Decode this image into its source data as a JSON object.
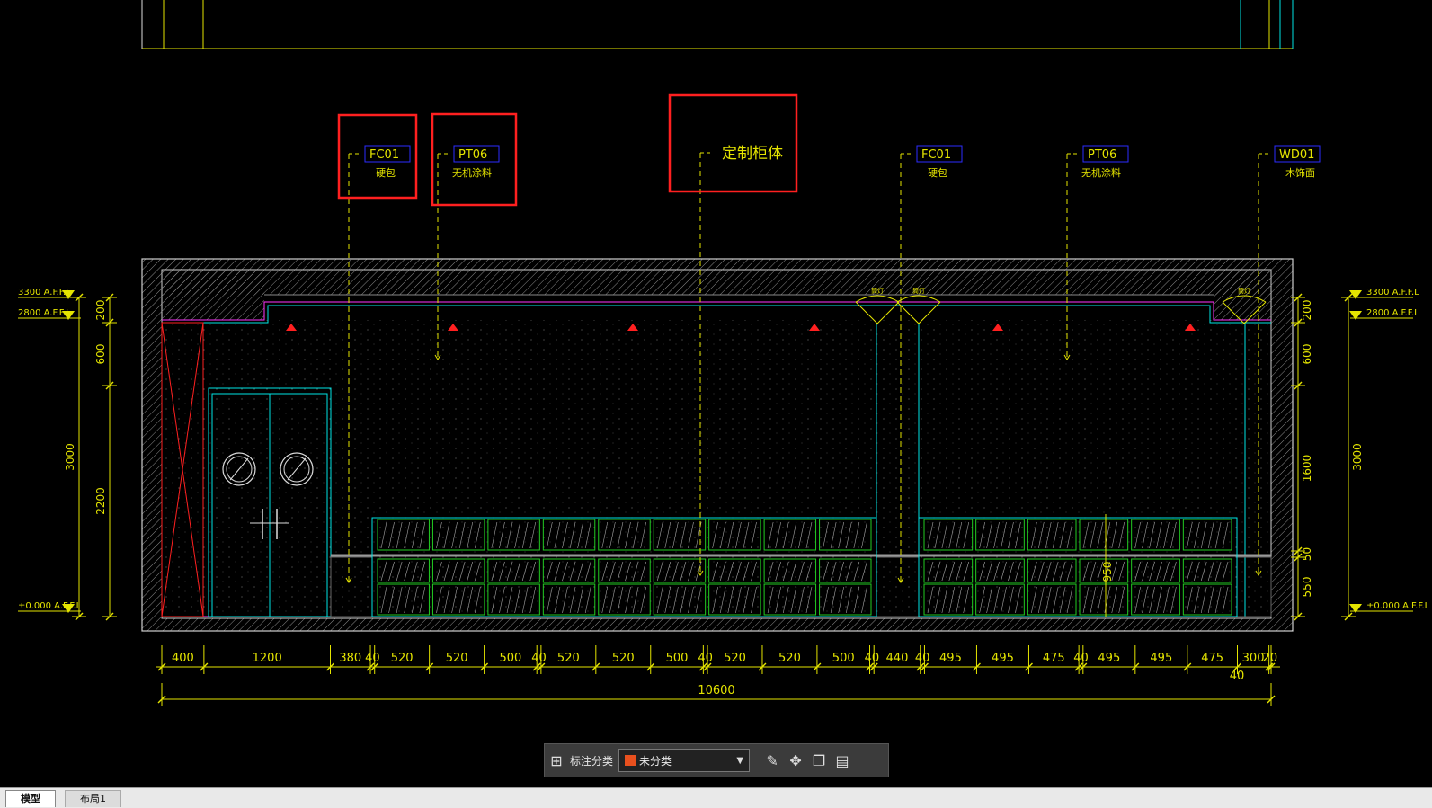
{
  "tags": [
    {
      "code": "FC01",
      "desc": "硬包",
      "boxed": true
    },
    {
      "code": "PT06",
      "desc": "无机涂料",
      "boxed": true
    },
    {
      "code": "定制柜体",
      "desc": "",
      "boxed": true
    },
    {
      "code": "FC01",
      "desc": "硬包",
      "boxed": false
    },
    {
      "code": "PT06",
      "desc": "无机涂料",
      "boxed": false
    },
    {
      "code": "WD01",
      "desc": "木饰面",
      "boxed": false
    }
  ],
  "levels_left": [
    "3300 A.F.F.L",
    "2800 A.F.F.L",
    "±0.000 A.F.F.L"
  ],
  "levels_right": [
    "3300 A.F.F.L",
    "2800 A.F.F.L",
    "±0.000 A.F.F.L"
  ],
  "dims_left_outer": [
    "3000"
  ],
  "dims_left_inner": [
    "200",
    "600",
    "2200"
  ],
  "dims_right_inner": [
    "200",
    "600",
    "1600",
    "50",
    "550"
  ],
  "dims_right_outer": [
    "3000"
  ],
  "dim_950": "950",
  "dims_bottom": [
    "400",
    "1200",
    "380",
    "40",
    "520",
    "520",
    "500",
    "40",
    "520",
    "520",
    "500",
    "40",
    "520",
    "520",
    "500",
    "40",
    "440",
    "40",
    "495",
    "495",
    "475",
    "40",
    "495",
    "495",
    "475",
    "300",
    "20"
  ],
  "dim_extra_40": "40",
  "dim_total": "10600",
  "lamp_labels": [
    "筒灯",
    "筒灯",
    "筒灯"
  ],
  "toolbar": {
    "label": "标注分类",
    "selected": "未分类",
    "swatch_color": "#e8501e",
    "icons": [
      "grid-icon",
      "edit-icon",
      "move-icon",
      "copy-icon",
      "paste-icon"
    ]
  },
  "tabs": [
    "模型",
    "布局1"
  ]
}
